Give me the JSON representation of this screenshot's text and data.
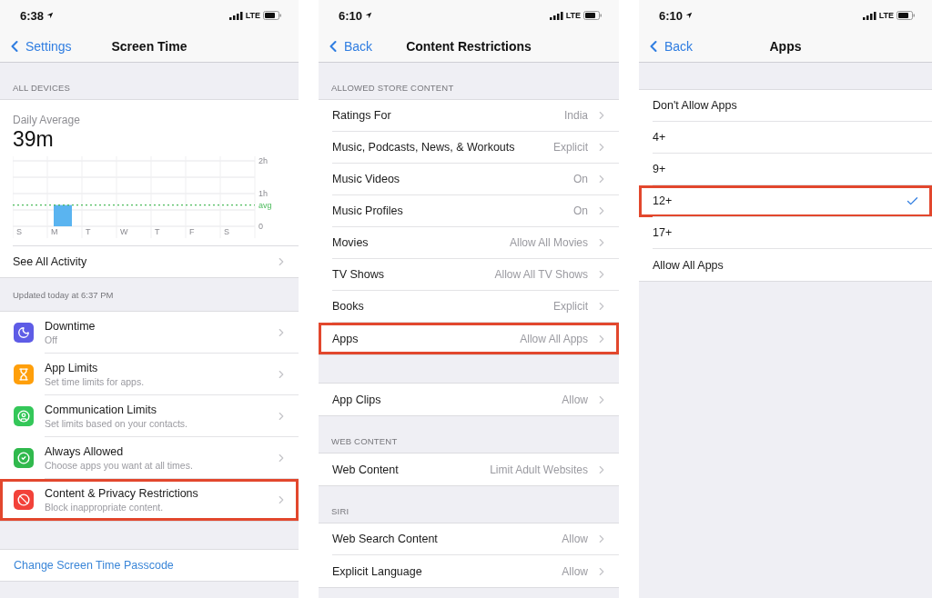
{
  "screens": [
    {
      "status_bar": {
        "time": "6:38",
        "network": "LTE"
      },
      "nav": {
        "back": "Settings",
        "title": "Screen Time"
      },
      "sections": [
        {
          "kind": "usage",
          "header": "ALL DEVICES",
          "caption": "Daily Average",
          "total": "39m",
          "link": "See All Activity",
          "chart_data": {
            "type": "bar",
            "categories": [
              "S",
              "M",
              "T",
              "W",
              "T",
              "F",
              "S"
            ],
            "values": [
              0,
              0.65,
              0,
              0,
              0,
              0,
              0
            ],
            "ylim": [
              0,
              2
            ],
            "yticks": [
              {
                "value": 0,
                "label": "0"
              },
              {
                "value": 1,
                "label": "1h"
              },
              {
                "value": 2,
                "label": "2h"
              }
            ],
            "ref_lines": [
              {
                "axis": "y",
                "value": 0.65,
                "label": "avg"
              }
            ]
          }
        },
        {
          "kind": "note",
          "text": "Updated today at 6:37 PM"
        },
        {
          "kind": "icon_list",
          "rows": [
            {
              "title": "Downtime",
              "subtitle": "Off",
              "color": "#5e5ce6",
              "highlighted": false
            },
            {
              "title": "App Limits",
              "subtitle": "Set time limits for apps.",
              "color": "#ff9f0a",
              "highlighted": false
            },
            {
              "title": "Communication Limits",
              "subtitle": "Set limits based on your contacts.",
              "color": "#34c759",
              "highlighted": false
            },
            {
              "title": "Always Allowed",
              "subtitle": "Choose apps you want at all times.",
              "color": "#30b94d",
              "highlighted": false
            },
            {
              "title": "Content & Privacy Restrictions",
              "subtitle": "Block inappropriate content.",
              "color": "#f2423a",
              "highlighted": true
            }
          ]
        },
        {
          "kind": "link",
          "text": "Change Screen Time Passcode"
        }
      ]
    },
    {
      "status_bar": {
        "time": "6:10",
        "network": "LTE"
      },
      "nav": {
        "back": "Back",
        "title": "Content Restrictions"
      },
      "sections": [
        {
          "kind": "list",
          "header": "ALLOWED STORE CONTENT",
          "rows": [
            {
              "label": "Ratings For",
              "value": "India",
              "highlighted": false
            },
            {
              "label": "Music, Podcasts, News, & Workouts",
              "value": "Explicit",
              "highlighted": false
            },
            {
              "label": "Music Videos",
              "value": "On",
              "highlighted": false
            },
            {
              "label": "Music Profiles",
              "value": "On",
              "highlighted": false
            },
            {
              "label": "Movies",
              "value": "Allow All Movies",
              "highlighted": false
            },
            {
              "label": "TV Shows",
              "value": "Allow All TV Shows",
              "highlighted": false
            },
            {
              "label": "Books",
              "value": "Explicit",
              "highlighted": false
            },
            {
              "label": "Apps",
              "value": "Allow All Apps",
              "highlighted": true
            }
          ]
        },
        {
          "kind": "list",
          "rows": [
            {
              "label": "App Clips",
              "value": "Allow",
              "highlighted": false
            }
          ]
        },
        {
          "kind": "list",
          "header": "WEB CONTENT",
          "rows": [
            {
              "label": "Web Content",
              "value": "Limit Adult Websites",
              "highlighted": false
            }
          ]
        },
        {
          "kind": "list",
          "header": "SIRI",
          "rows": [
            {
              "label": "Web Search Content",
              "value": "Allow",
              "highlighted": false
            },
            {
              "label": "Explicit Language",
              "value": "Allow",
              "highlighted": false
            }
          ]
        }
      ]
    },
    {
      "status_bar": {
        "time": "6:10",
        "network": "LTE"
      },
      "nav": {
        "back": "Back",
        "title": "Apps"
      },
      "sections": [
        {
          "kind": "choices",
          "rows": [
            {
              "label": "Don't Allow Apps",
              "selected": false,
              "highlighted": false
            },
            {
              "label": "4+",
              "selected": false,
              "highlighted": false
            },
            {
              "label": "9+",
              "selected": false,
              "highlighted": false
            },
            {
              "label": "12+",
              "selected": true,
              "highlighted": true
            },
            {
              "label": "17+",
              "selected": false,
              "highlighted": false
            },
            {
              "label": "Allow All Apps",
              "selected": false,
              "highlighted": false
            }
          ]
        }
      ]
    }
  ]
}
